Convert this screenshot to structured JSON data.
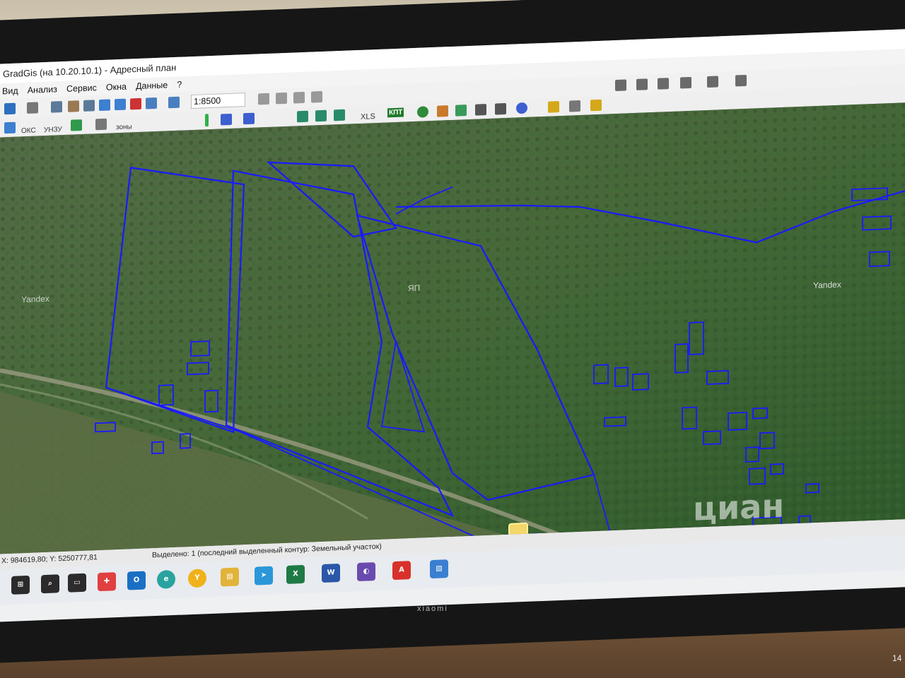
{
  "window": {
    "title": "GradGis (на 10.20.10.1) - Адресный план"
  },
  "menu": [
    "Вид",
    "Анализ",
    "Сервис",
    "Окна",
    "Данные",
    "?"
  ],
  "toolbar": {
    "scale": "1:8500",
    "xls_label": "XLS",
    "kpt_label": "КПТ",
    "okc_label": "ОКС",
    "zu_label": "УНЗУ",
    "zones_label": "зоны"
  },
  "map": {
    "watermark_left": "Yandex",
    "watermark_right": "Yandex",
    "watermark_center": "ЯП",
    "overlay_watermark": "циан",
    "plot_stroke_color": "#1a1aff",
    "selected_plot_color": "#f4d76a",
    "base_layer": "satellite-imagery"
  },
  "status": {
    "coordinates": "X: 984619,80; Y: 5250777,81",
    "selection": "Выделено: 1 (последний выделенный контур: Земельный участок)"
  },
  "taskbar": {
    "icons": [
      "windows-start-icon",
      "search-icon",
      "task-view-icon",
      "pin-app-icon",
      "outlook-icon",
      "edge-icon",
      "yandex-browser-icon",
      "file-explorer-icon",
      "telegram-icon",
      "excel-icon",
      "word-icon",
      "vpn-icon",
      "acrobat-icon",
      "photos-icon"
    ]
  },
  "monitor": {
    "brand": "xiaomi",
    "clock_fragment": "14"
  }
}
